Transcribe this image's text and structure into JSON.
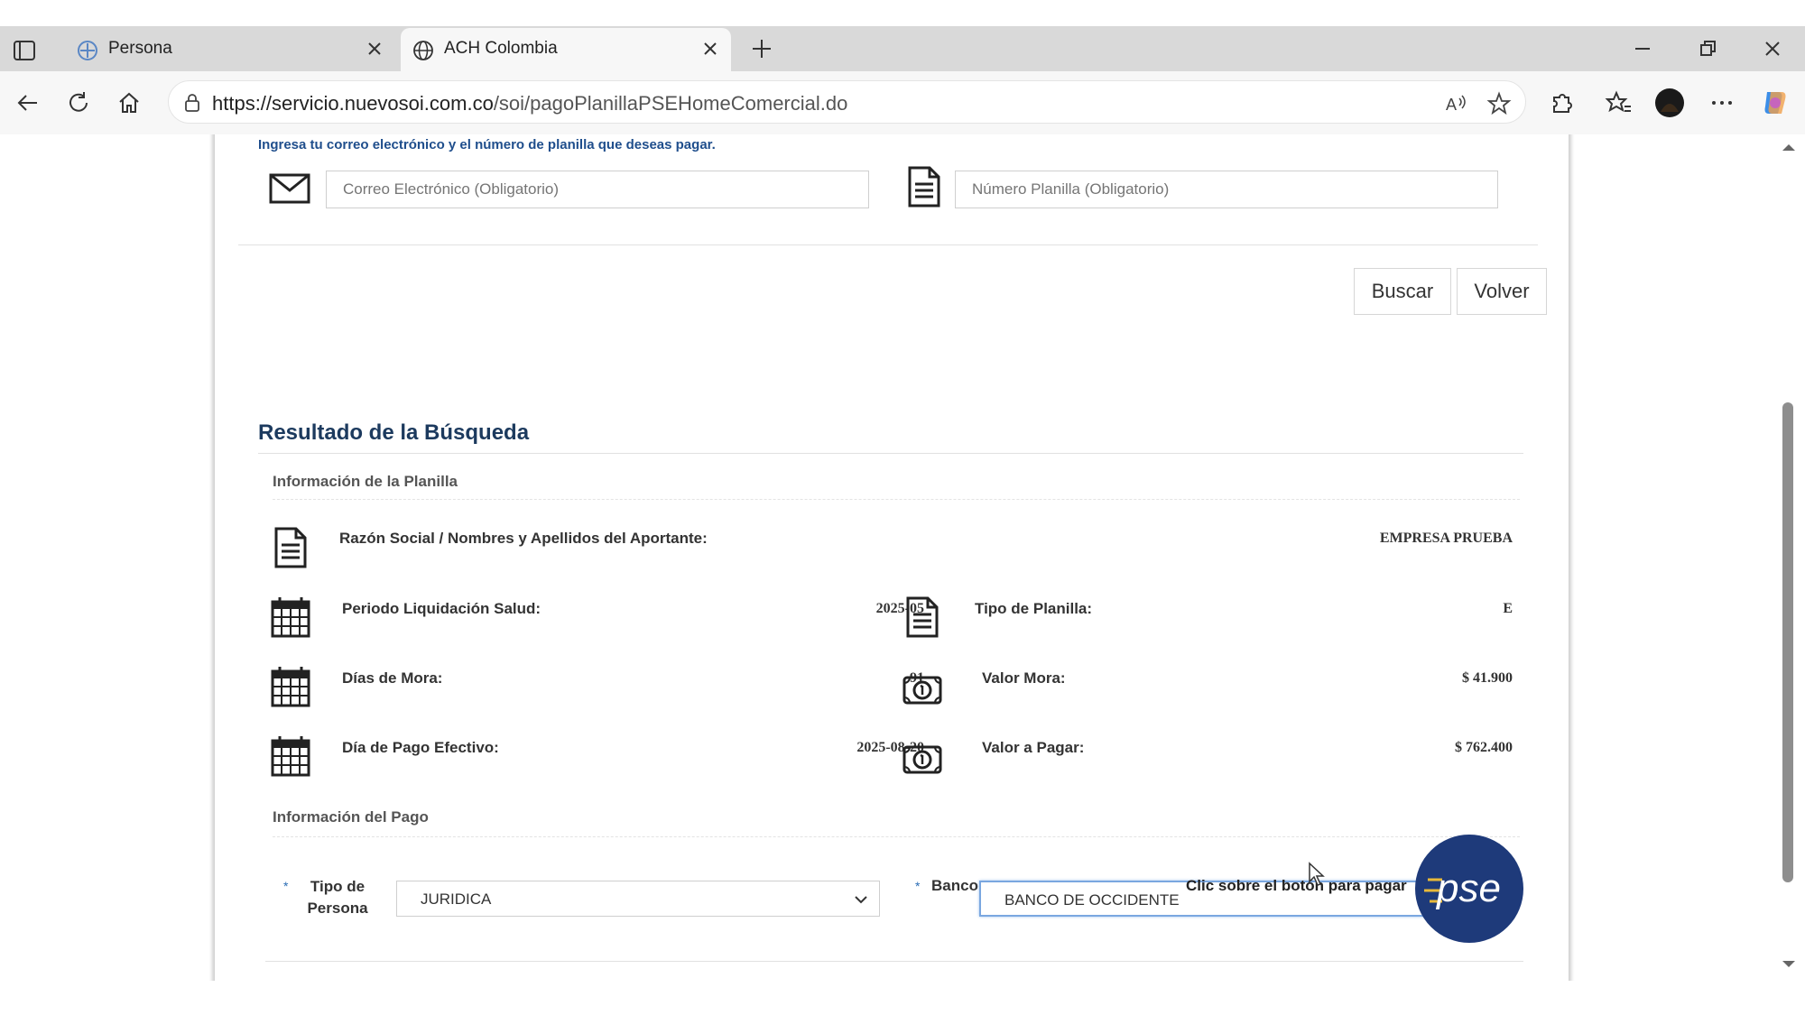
{
  "browser": {
    "tabs": [
      {
        "title": "Persona",
        "icon": "persona-favicon-icon"
      },
      {
        "title": "ACH Colombia",
        "icon": "globe-icon"
      }
    ],
    "url_domain": "https://servicio.nuevosoi.com.co",
    "url_path": "/soi/pagoPlanillaPSEHomeComercial.do"
  },
  "form": {
    "intro": "Ingresa tu correo electrónico y el número de planilla que deseas pagar.",
    "email_placeholder": "Correo Electrónico (Obligatorio)",
    "planilla_placeholder": "Número Planilla (Obligatorio)",
    "search_label": "Buscar",
    "back_label": "Volver"
  },
  "results": {
    "title": "Resultado de la Búsqueda",
    "planilla_section": "Información de la Planilla",
    "razon_label": "Razón Social / Nombres y Apellidos del Aportante:",
    "razon_value": "EMPRESA PRUEBA",
    "periodo_label": "Periodo Liquidación Salud:",
    "periodo_value": "2025-05",
    "tipo_planilla_label": "Tipo de Planilla:",
    "tipo_planilla_value": "E",
    "dias_mora_label": "Días de Mora:",
    "dias_mora_value": "91",
    "valor_mora_label": "Valor Mora:",
    "valor_mora_value": "$ 41.900",
    "dia_pago_label": "Día de Pago Efectivo:",
    "dia_pago_value": "2025-08-20",
    "valor_pagar_label": "Valor a Pagar:",
    "valor_pagar_value": "$ 762.400"
  },
  "payment": {
    "section": "Información del Pago",
    "required_mark": "*",
    "tipo_persona_label_1": "Tipo de",
    "tipo_persona_label_2": "Persona",
    "tipo_persona_value": "JURIDICA",
    "banco_label": "Banco",
    "banco_value": "BANCO DE OCCIDENTE",
    "pay_prompt": "Clic sobre el botón para pagar",
    "pse_text": "pse"
  },
  "colors": {
    "accent": "#1f4e8c",
    "pse_blue": "#1e3a7a"
  }
}
